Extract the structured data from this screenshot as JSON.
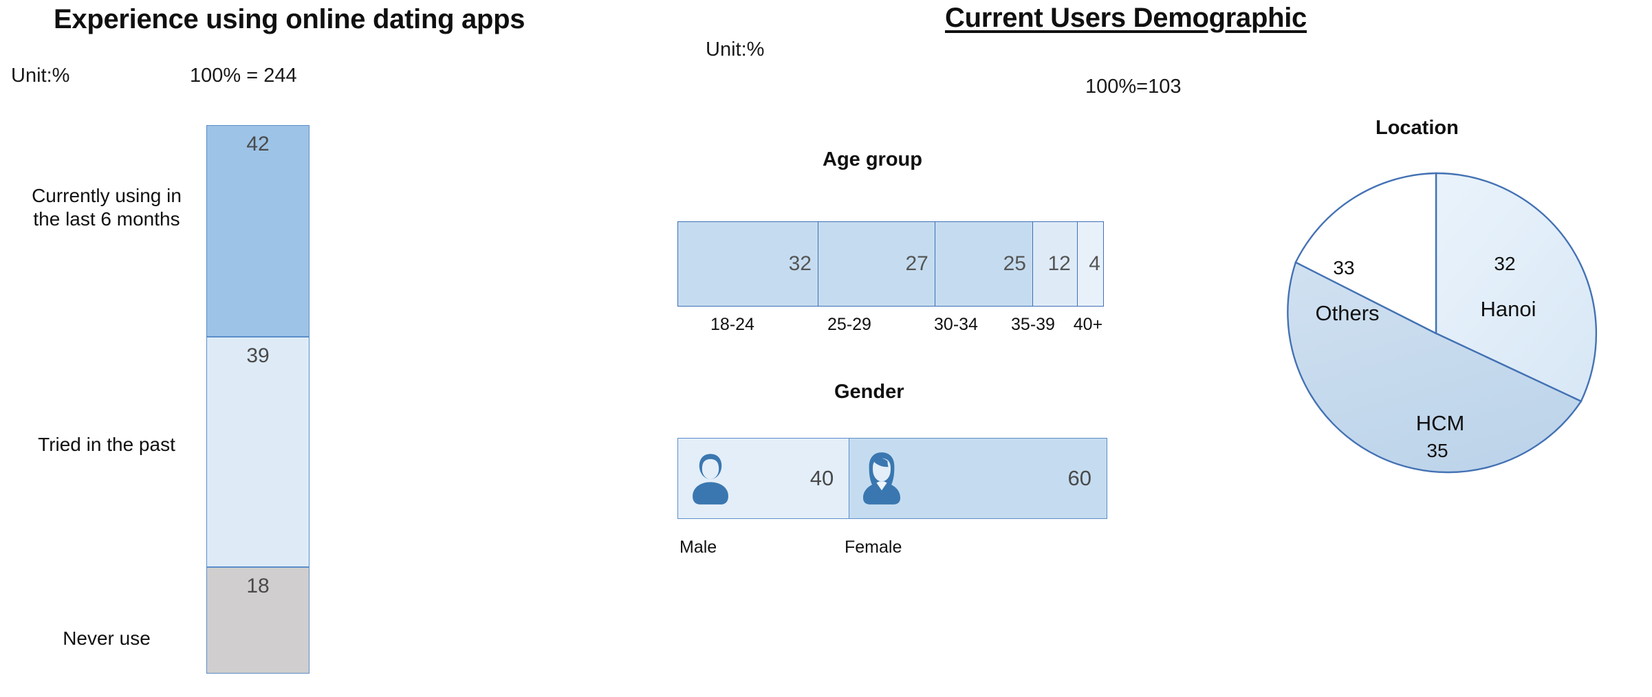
{
  "left_panel": {
    "title": "Experience using online dating apps",
    "unit_note": "Unit:%",
    "base_note": "100% = 244"
  },
  "right_panel": {
    "title": "Current Users Demographic",
    "unit_note": "Unit:%",
    "base_note": "100%=103"
  },
  "sections": {
    "age_title": "Age group",
    "gender_title": "Gender",
    "location_title": "Location"
  },
  "icons": {
    "male": "male-person-icon",
    "female": "female-person-icon"
  },
  "colors": {
    "blue_dark": "#9dc3e6",
    "blue_light": "#deebf7",
    "blue_mid": "#c5dcf0",
    "grey": "#d0cece",
    "border_blue": "#5b8ec9",
    "border_blue_dark": "#3f6fb5",
    "pie_hanoi": "#e3eef9",
    "pie_hcm": "#c6dbee",
    "pie_others": "#ffffff"
  },
  "chart_data": [
    {
      "type": "bar",
      "id": "experience-stacked-bar",
      "orientation": "vertical-stacked",
      "title": "Experience using online dating apps",
      "unit": "%",
      "base": "100% = 244",
      "categories": [
        "Currently using in the last 6 months",
        "Tried in the past",
        "Never use"
      ],
      "values": [
        42,
        39,
        18
      ],
      "segment_colors": [
        "#9dc3e6",
        "#deebf7",
        "#d0cece"
      ],
      "xlabel": "",
      "ylabel": "",
      "grid": false,
      "legend": "none"
    },
    {
      "type": "bar",
      "id": "age-group-bar",
      "orientation": "horizontal-stacked",
      "title": "Age group",
      "unit": "%",
      "base": "100%=103",
      "categories": [
        "18-24",
        "25-29",
        "30-34",
        "35-39",
        "40+"
      ],
      "values": [
        32,
        27,
        25,
        12,
        4
      ],
      "segment_colors": [
        "#c5dcf0",
        "#c5dcf0",
        "#c5dcf0",
        "#deebf7",
        "#e8f1fa"
      ],
      "xlabel": "",
      "ylabel": "",
      "grid": false,
      "legend": "none"
    },
    {
      "type": "bar",
      "id": "gender-bar",
      "orientation": "horizontal-stacked",
      "title": "Gender",
      "unit": "%",
      "base": "100%=103",
      "categories": [
        "Male",
        "Female"
      ],
      "values": [
        40,
        60
      ],
      "segment_colors": [
        "#e3eef9",
        "#c5dcf0"
      ],
      "xlabel": "",
      "ylabel": "",
      "grid": false,
      "legend": "none"
    },
    {
      "type": "pie",
      "id": "location-pie",
      "title": "Location",
      "unit": "%",
      "base": "100%=103",
      "labels": [
        "Hanoi",
        "HCM",
        "Others"
      ],
      "values": [
        32,
        35,
        33
      ],
      "slice_colors": [
        "#e3eef9",
        "#c6dbee",
        "#ffffff"
      ],
      "start_angle_deg": 0,
      "direction": "clockwise",
      "legend": "labels-inside"
    }
  ],
  "left_chart": {
    "segments": [
      {
        "label": "Currently using in the last 6 months",
        "value": "42"
      },
      {
        "label": "Tried in the past",
        "value": "39"
      },
      {
        "label": "Never use",
        "value": "18"
      }
    ]
  },
  "age_chart": {
    "segments": [
      {
        "label": "18-24",
        "value": "32"
      },
      {
        "label": "25-29",
        "value": "27"
      },
      {
        "label": "30-34",
        "value": "25"
      },
      {
        "label": "35-39",
        "value": "12"
      },
      {
        "label": "40+",
        "value": "4"
      }
    ]
  },
  "gender_chart": {
    "segments": [
      {
        "label": "Male",
        "value": "40"
      },
      {
        "label": "Female",
        "value": "60"
      }
    ]
  },
  "location_chart": {
    "slices": [
      {
        "label": "Hanoi",
        "value": "32"
      },
      {
        "label": "HCM",
        "value": "35"
      },
      {
        "label": "Others",
        "value": "33"
      }
    ]
  }
}
